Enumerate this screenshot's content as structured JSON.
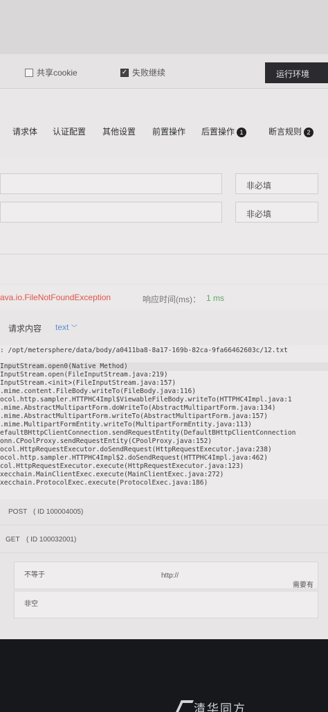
{
  "options": {
    "share_cookie_label": "共享cookie",
    "share_cookie_checked": false,
    "fail_continue_label": "失败继续",
    "fail_continue_checked": true,
    "run_env_label": "运行环境"
  },
  "tabs": [
    {
      "label": "请求体"
    },
    {
      "label": "认证配置"
    },
    {
      "label": "其他设置"
    },
    {
      "label": "前置操作"
    },
    {
      "label": "后置操作",
      "badge": "1"
    },
    {
      "label": "断言规则",
      "badge": "2"
    }
  ],
  "form": {
    "optional_1": "非必填",
    "optional_2": "非必填"
  },
  "response": {
    "error": "ava.io.FileNotFoundException",
    "time_label": "响应时间(ms)：",
    "time_value": "1 ms"
  },
  "request": {
    "label": "请求内容",
    "type": "text"
  },
  "stack_trace": [
    ": /opt/metersphere/data/body/a0411ba8-8a17-169b-82ca-9fa66462603c/12.txt",
    "InputStream.open0(Native Method)",
    "InputStream.open(FileInputStream.java:219)",
    "InputStream.<init>(FileInputStream.java:157)",
    ".mime.content.FileBody.writeTo(FileBody.java:116)",
    "ocol.http.sampler.HTTPHC4Impl$ViewableFileBody.writeTo(HTTPHC4Impl.java:1",
    ".mime.AbstractMultipartForm.doWriteTo(AbstractMultipartForm.java:134)",
    ".mime.AbstractMultipartForm.writeTo(AbstractMultipartForm.java:157)",
    ".mime.MultipartFormEntity.writeTo(MultipartFormEntity.java:113)",
    "efaultBHttpClientConnection.sendRequestEntity(DefaultBHttpClientConnection",
    "onn.CPoolProxy.sendRequestEntity(CPoolProxy.java:152)",
    "ocol.HttpRequestExecutor.doSendRequest(HttpRequestExecutor.java:238)",
    "ocol.http.sampler.HTTPHC4Impl$2.doSendRequest(HTTPHC4Impl.java:462)",
    "col.HttpRequestExecutor.execute(HttpRequestExecutor.java:123)",
    "xecchain.MainClientExec.execute(MainClientExec.java:272)",
    "xecchain.ProtocolExec.execute(ProtocolExec.java:186)"
  ],
  "apis": [
    {
      "method": "POST",
      "id_text": "( ID 100004005)"
    },
    {
      "method": "GET",
      "id_text": "( ID 100032001)"
    }
  ],
  "assertions": {
    "not_equal": "不等于",
    "http_prefix": "http://",
    "required_hint": "需要有配置",
    "not_empty": "非空"
  },
  "brand": "清华同方",
  "colors": {
    "error": "#e2514a",
    "success": "#5fa86a",
    "link": "#5a8fd0",
    "dark_button": "#2b2b2f"
  }
}
